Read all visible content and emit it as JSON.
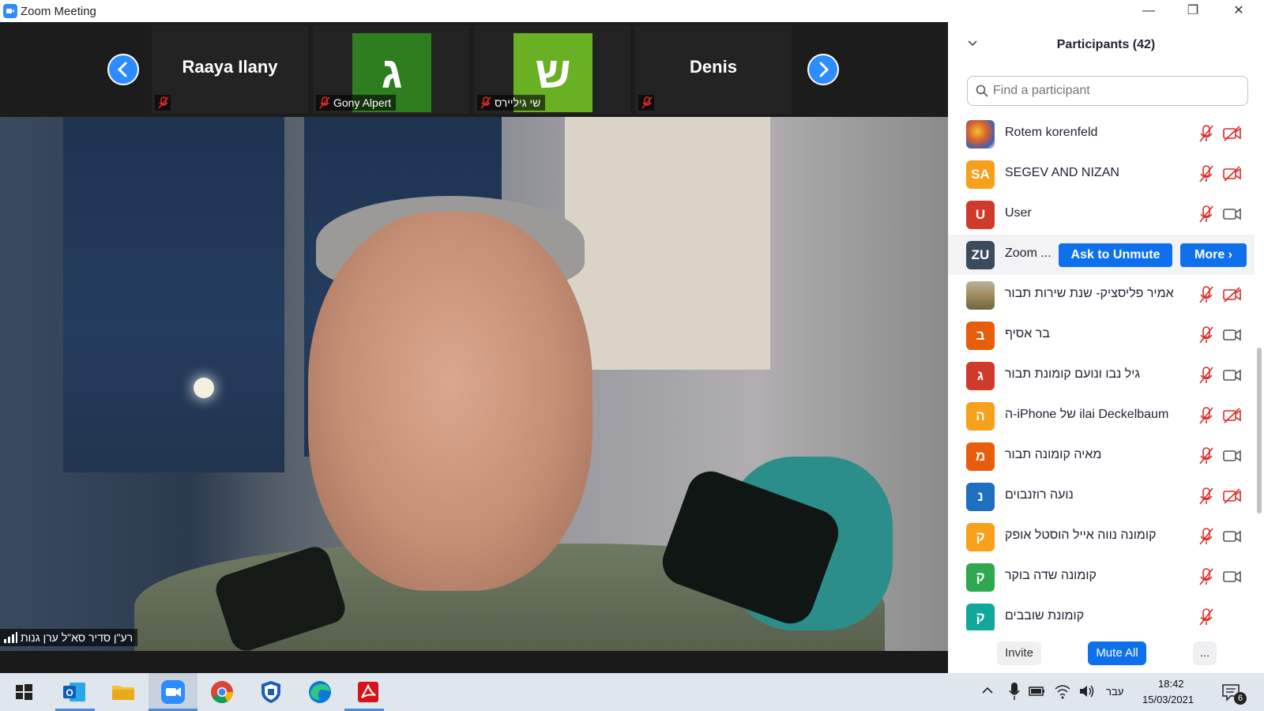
{
  "window": {
    "title": "Zoom Meeting",
    "controls": [
      "—",
      "❐",
      "✕"
    ]
  },
  "strip": {
    "tiles": [
      {
        "name": "Raaya Ilany",
        "style": "name"
      },
      {
        "name": "Gony Alpert",
        "initial": "ג",
        "color": "#2e7d1e",
        "style": "square"
      },
      {
        "name": "שי גיליירס",
        "initial": "ש",
        "color": "#6ab023",
        "style": "square"
      },
      {
        "name": "Denis",
        "style": "name"
      }
    ]
  },
  "main_video": {
    "speaker_label": "רע\"ן סדיר סא\"ל ערן גנות"
  },
  "panel": {
    "title": "Participants (42)",
    "search_placeholder": "Find a participant",
    "participants": [
      {
        "name": "Rotem korenfeld",
        "avatar_type": "image",
        "mic": "muted",
        "cam": "off"
      },
      {
        "name": "SEGEV AND NIZAN",
        "initials": "SA",
        "color": "#f7a01c",
        "mic": "muted",
        "cam": "off"
      },
      {
        "name": "User",
        "initials": "U",
        "color": "#d03a2b",
        "mic": "muted",
        "cam": "on"
      },
      {
        "name": "Zoom ...",
        "initials": "ZU",
        "color": "#3a4b5e",
        "highlighted": true,
        "actions": {
          "ask_unmute": "Ask to Unmute",
          "more": "More ›"
        }
      },
      {
        "name": "אמיר פליסציק- שנת שירות תבור",
        "avatar_type": "image",
        "mic": "muted",
        "cam": "off"
      },
      {
        "name": "בר אסיף",
        "initials": "ב",
        "color": "#e85d0c",
        "mic": "muted",
        "cam": "on"
      },
      {
        "name": "גיל נבו ונועם קומונת תבור",
        "initials": "ג",
        "color": "#d03a2b",
        "mic": "muted",
        "cam": "on"
      },
      {
        "name": "ה-iPhone של ilai Deckelbaum",
        "initials": "ה",
        "color": "#f7a01c",
        "mic": "muted",
        "cam": "off"
      },
      {
        "name": "מאיה קומונה תבור",
        "initials": "מ",
        "color": "#e85d0c",
        "mic": "muted",
        "cam": "on"
      },
      {
        "name": "נועה רוזנבוים",
        "initials": "נ",
        "color": "#1e6fbf",
        "mic": "muted",
        "cam": "off"
      },
      {
        "name": "קומונה נווה אייל הוסטל אופק",
        "initials": "ק",
        "color": "#f7a01c",
        "mic": "muted",
        "cam": "on"
      },
      {
        "name": "קומונה שדה בוקר",
        "initials": "ק",
        "color": "#2fa84f",
        "mic": "muted",
        "cam": "on"
      },
      {
        "name": "קומונת שובבים",
        "initials": "ק",
        "color": "#11a79a",
        "mic": "muted",
        "cam": "on"
      }
    ],
    "footer": {
      "invite": "Invite",
      "mute_all": "Mute All",
      "more": "..."
    }
  },
  "taskbar": {
    "apps": [
      "windows-start",
      "outlook",
      "file-explorer",
      "zoom",
      "chrome",
      "defender",
      "edge",
      "acrobat"
    ],
    "language": "עבר",
    "time": "18:42",
    "date": "15/03/2021",
    "notifications": "6"
  },
  "colors": {
    "accent": "#2d8cff",
    "button_blue": "#0e71eb",
    "muted_red": "#e02828"
  }
}
